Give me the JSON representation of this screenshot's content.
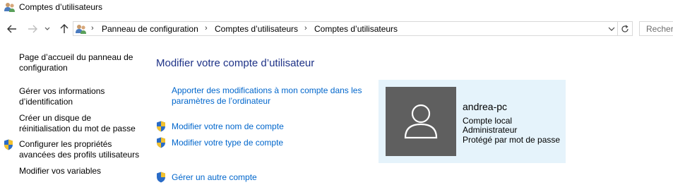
{
  "window": {
    "title": "Comptes d’utilisateurs",
    "icon": "users-icon"
  },
  "nav": {
    "back_icon": "arrow-left-icon",
    "forward_icon": "arrow-right-icon",
    "recent_icon": "chevron-down-icon",
    "up_icon": "arrow-up-icon"
  },
  "address": {
    "crumbs": [
      "Panneau de configuration",
      "Comptes d’utilisateurs",
      "Comptes d’utilisateurs"
    ],
    "separator": "›"
  },
  "search": {
    "placeholder": "Recher"
  },
  "sidebar": {
    "links": [
      {
        "line1": "Page d’accueil du panneau de",
        "line2": "configuration"
      },
      {
        "line1": "Gérer vos informations",
        "line2": "d’identification"
      },
      {
        "line1": "Créer un disque de",
        "line2": "réinitialisation du mot de passe"
      },
      {
        "line1": "Configurer les propriétés",
        "line2": "avancées des profils utilisateurs"
      },
      {
        "line1": "Modifier vos variables",
        "line2": ""
      }
    ]
  },
  "main": {
    "title": "Modifier votre compte d’utilisateur",
    "tasks": [
      {
        "line1": "Apporter des modifications à mon compte dans les",
        "line2": "paramètres de l’ordinateur"
      },
      {
        "line1": "Modifier votre nom de compte"
      },
      {
        "line1": "Modifier votre type de compte"
      },
      {
        "line1": "Gérer un autre compte"
      }
    ]
  },
  "account": {
    "name": "andrea-pc",
    "type": "Compte local",
    "role": "Administrateur",
    "protection": "Protégé par mot de passe"
  },
  "colors": {
    "link": "#0066cc",
    "heading": "#1e3287",
    "card_bg": "#e5f3fb",
    "avatar_bg": "#5f5f5f"
  }
}
